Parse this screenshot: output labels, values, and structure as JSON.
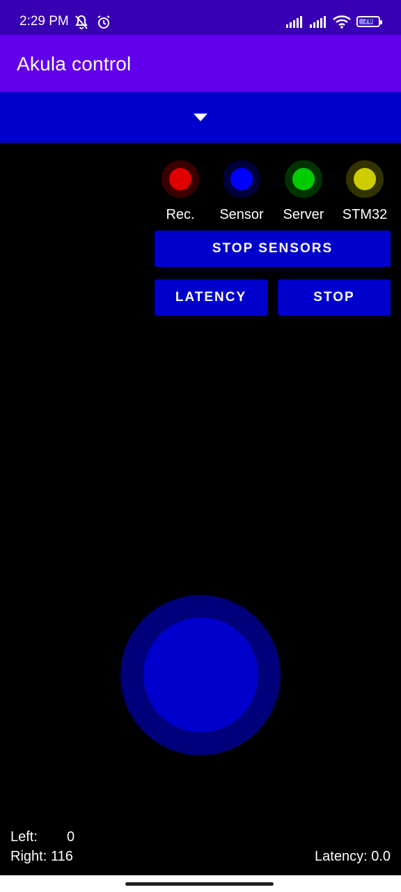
{
  "status_bar": {
    "time": "2:29 PM",
    "battery": "76",
    "battery_level": 0.76,
    "icons": [
      "mute-icon",
      "alarm-icon",
      "signal-icon",
      "signal-icon",
      "wifi-icon",
      "battery-icon"
    ]
  },
  "app_bar": {
    "title": "Akula control"
  },
  "dropdown": {
    "icon": "dropdown-arrow-icon"
  },
  "indicators": [
    {
      "label": "Rec.",
      "color": "#e00000",
      "glow": "#3a0000"
    },
    {
      "label": "Sensor",
      "color": "#0000ff",
      "glow": "#00003a"
    },
    {
      "label": "Server",
      "color": "#00cc00",
      "glow": "#003300"
    },
    {
      "label": "STM32",
      "color": "#cccc00",
      "glow": "#333300"
    }
  ],
  "buttons": {
    "stop_sensors": "STOP SENSORS",
    "latency": "LATENCY",
    "stop": "STOP"
  },
  "joystick": {
    "outer_color": "#00007a",
    "knob_color": "#0000cc"
  },
  "readouts": {
    "left_label": "Left:",
    "left_value": "0",
    "right_label": "Right:",
    "right_value": "116",
    "latency": "Latency: 0.0"
  },
  "colors": {
    "status_bar": "#3700b3",
    "app_bar": "#6200ee",
    "accent_blue": "#0000cc",
    "background": "#000000"
  }
}
